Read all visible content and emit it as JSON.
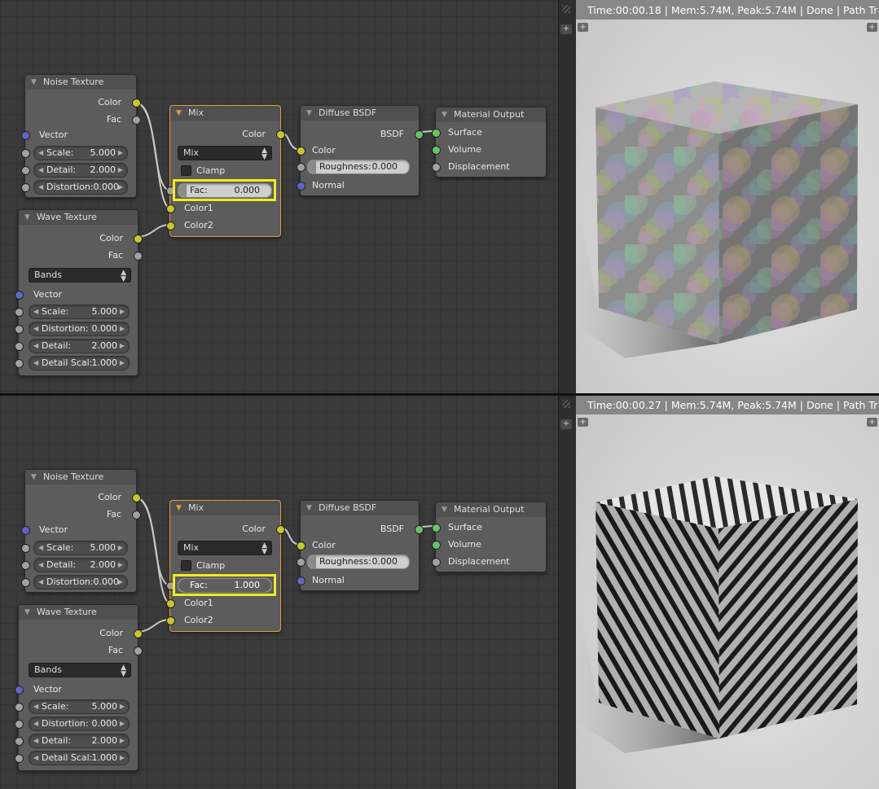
{
  "panels": [
    {
      "noise": {
        "title": "Noise Texture",
        "out_color": "Color",
        "out_fac": "Fac",
        "in_vector": "Vector",
        "scale": {
          "label": "Scale:",
          "value": "5.000"
        },
        "detail": {
          "label": "Detail:",
          "value": "2.000"
        },
        "distortion": {
          "label": "Distortion:",
          "value": "0.000"
        }
      },
      "wave": {
        "title": "Wave Texture",
        "out_color": "Color",
        "out_fac": "Fac",
        "mode": "Bands",
        "in_vector": "Vector",
        "scale": {
          "label": "Scale:",
          "value": "5.000"
        },
        "distortion": {
          "label": "Distortion:",
          "value": "0.000"
        },
        "detail": {
          "label": "Detail:",
          "value": "2.000"
        },
        "detail_scale": {
          "label": "Detail Scal:",
          "value": "1.000"
        }
      },
      "mix": {
        "title": "Mix",
        "out_color": "Color",
        "blend": "Mix",
        "clamp": "Clamp",
        "fac_label": "Fac:",
        "fac_value": "0.000",
        "fac_fraction": 0.0,
        "color1": "Color1",
        "color2": "Color2"
      },
      "diffuse": {
        "title": "Diffuse BSDF",
        "out_bsdf": "BSDF",
        "in_color": "Color",
        "roughness_label": "Roughness:",
        "roughness_value": "0.000",
        "in_normal": "Normal"
      },
      "output": {
        "title": "Material Output",
        "surface": "Surface",
        "volume": "Volume",
        "displacement": "Displacement"
      },
      "render": {
        "status": "Time:00:00.18 | Mem:5.74M, Peak:5.74M | Done | Path Tr",
        "texture": "noise"
      }
    },
    {
      "noise": {
        "title": "Noise Texture",
        "out_color": "Color",
        "out_fac": "Fac",
        "in_vector": "Vector",
        "scale": {
          "label": "Scale:",
          "value": "5.000"
        },
        "detail": {
          "label": "Detail:",
          "value": "2.000"
        },
        "distortion": {
          "label": "Distortion:",
          "value": "0.000"
        }
      },
      "wave": {
        "title": "Wave Texture",
        "out_color": "Color",
        "out_fac": "Fac",
        "mode": "Bands",
        "in_vector": "Vector",
        "scale": {
          "label": "Scale:",
          "value": "5.000"
        },
        "distortion": {
          "label": "Distortion:",
          "value": "0.000"
        },
        "detail": {
          "label": "Detail:",
          "value": "2.000"
        },
        "detail_scale": {
          "label": "Detail Scal:",
          "value": "1.000"
        }
      },
      "mix": {
        "title": "Mix",
        "out_color": "Color",
        "blend": "Mix",
        "clamp": "Clamp",
        "fac_label": "Fac:",
        "fac_value": "1.000",
        "fac_fraction": 1.0,
        "color1": "Color1",
        "color2": "Color2"
      },
      "diffuse": {
        "title": "Diffuse BSDF",
        "out_bsdf": "BSDF",
        "in_color": "Color",
        "roughness_label": "Roughness:",
        "roughness_value": "0.000",
        "in_normal": "Normal"
      },
      "output": {
        "title": "Material Output",
        "surface": "Surface",
        "volume": "Volume",
        "displacement": "Displacement"
      },
      "render": {
        "status": "Time:00:00.27 | Mem:5.74M, Peak:5.74M | Done | Path Tr",
        "texture": "waves"
      }
    }
  ],
  "colors": {
    "highlight": "#f3ea1c",
    "active_node": "#e39a3a",
    "socket_color": "#c7c729",
    "socket_vector": "#6363c7",
    "socket_shader": "#63c763"
  }
}
